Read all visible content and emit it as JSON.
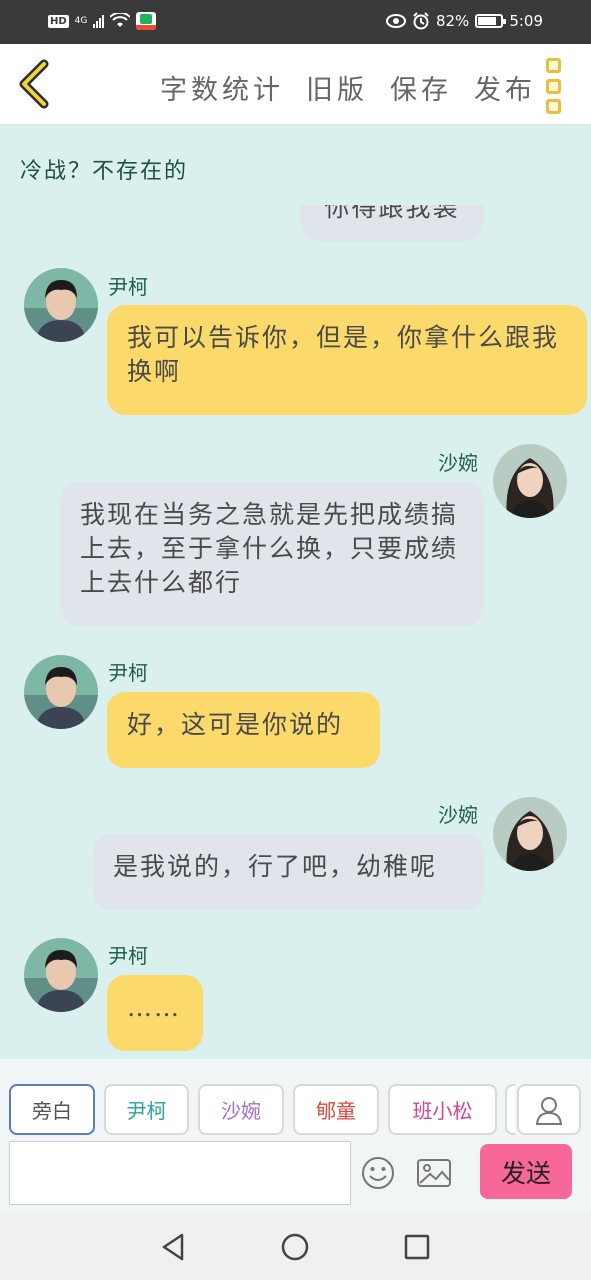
{
  "status_bar": {
    "hd": "HD",
    "network": "4G",
    "battery_text": "82%",
    "battery_level": 0.82,
    "time": "5:09"
  },
  "toolbar": {
    "actions": [
      "字数统计",
      "旧版",
      "保存",
      "发布"
    ]
  },
  "chat": {
    "title": "冷战？不存在的",
    "partial_message": "你得跟我装",
    "messages": [
      {
        "speaker": "尹柯",
        "side": "left",
        "text": "我可以告诉你，但是，你拿什么跟我换啊"
      },
      {
        "speaker": "沙婉",
        "side": "right",
        "text": "我现在当务之急就是先把成绩搞上去，至于拿什么换，只要成绩上去什么都行"
      },
      {
        "speaker": "尹柯",
        "side": "left",
        "text": "好，这可是你说的"
      },
      {
        "speaker": "沙婉",
        "side": "right",
        "text": "是我说的，行了吧，幼稚呢"
      },
      {
        "speaker": "尹柯",
        "side": "left",
        "text": "……"
      }
    ]
  },
  "characters": [
    {
      "label": "旁白",
      "color": "#555555"
    },
    {
      "label": "尹柯",
      "color": "#2aa3a0"
    },
    {
      "label": "沙婉",
      "color": "#a86cc4"
    },
    {
      "label": "郇童",
      "color": "#d94a3d"
    },
    {
      "label": "班小松",
      "color": "#d6458f"
    }
  ],
  "composer": {
    "input_value": "",
    "send_label": "发送"
  },
  "colors": {
    "chat_bg": "#daf0ee",
    "left_bubble": "#fcd96b",
    "right_bubble": "#e0e5ec",
    "send_button": "#f7679a",
    "accent": "#e8bf3d"
  },
  "icons": [
    "back-chevron-icon",
    "menu-dots-icon",
    "add-character-icon",
    "emoji-icon",
    "image-icon",
    "nav-back-icon",
    "nav-home-icon",
    "nav-recents-icon"
  ]
}
